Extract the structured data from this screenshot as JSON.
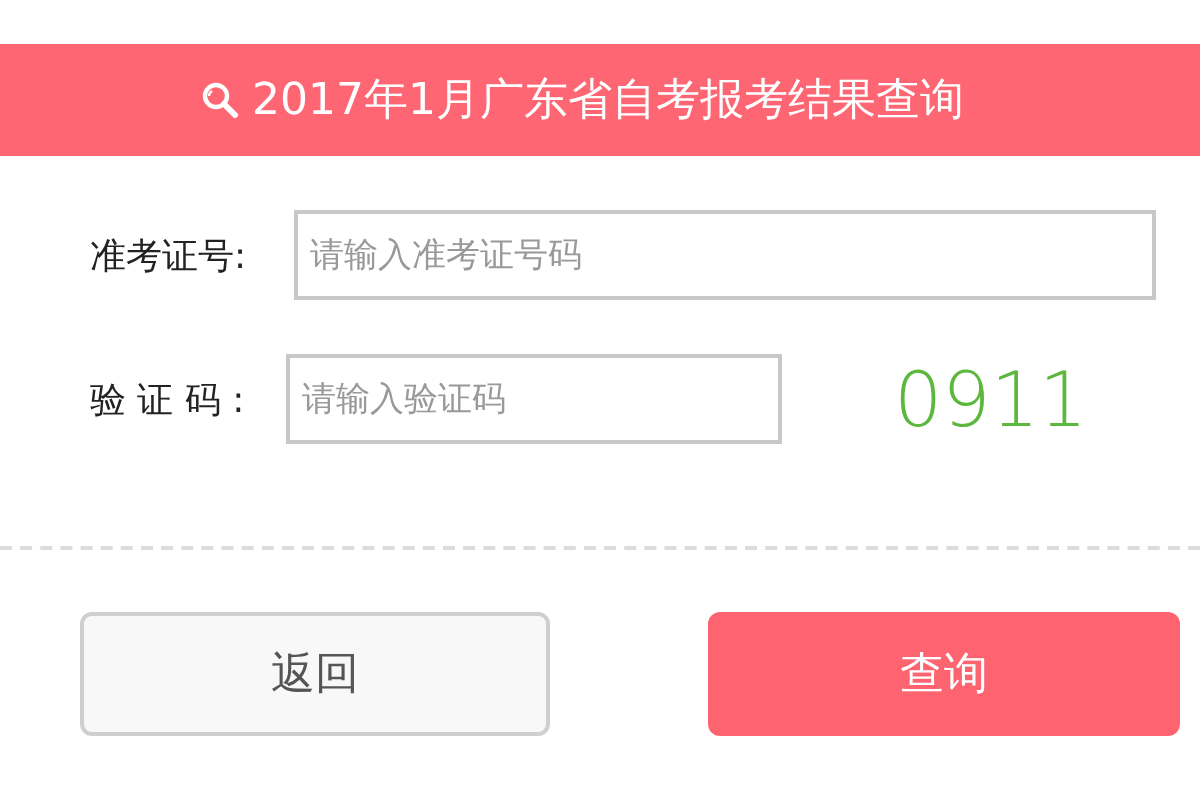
{
  "header": {
    "title": "2017年1月广东省自考报考结果查询"
  },
  "fields": [
    {
      "label": "准考证号:",
      "placeholder": "请输入准考证号码",
      "kind": "wide"
    },
    {
      "label": "验 证 码 :",
      "placeholder": "请输入验证码",
      "kind": "captcha",
      "code": "0911"
    }
  ],
  "buttons": [
    {
      "label": "返回",
      "kind": "secondary"
    },
    {
      "label": "查询",
      "kind": "primary"
    }
  ]
}
